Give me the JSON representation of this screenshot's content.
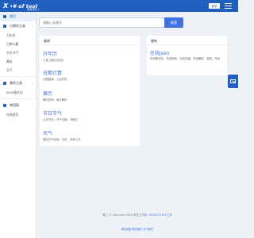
{
  "header": {
    "logo_mark": "X",
    "logo_text": "•¥ of tool",
    "link_label": "快速导航",
    "link_arrow": "▾",
    "login_label": "登录",
    "menu_icon": "hamburger-icon"
  },
  "sidebar": {
    "home": "首页",
    "groups": [
      {
        "label": "日期时工具",
        "items": [
          "万年历",
          "日期计算",
          "节日节气",
          "黄历",
          "天气"
        ]
      },
      {
        "label": "我的工具",
        "items": [
          "JSON格式化"
        ]
      },
      {
        "label": "常用网",
        "items": [
          "在线网页"
        ]
      }
    ],
    "caret": "›"
  },
  "search": {
    "placeholder": "请输入关键字",
    "button_label": "搜索"
  },
  "left_card": {
    "title": "最常",
    "tools": [
      {
        "name": "万年历",
        "desc": "工具,日期,万年历"
      },
      {
        "name": "日期计算",
        "desc": "日期相减，公历农历"
      },
      {
        "name": "黄历",
        "desc": "黄历查询，每日黄历"
      },
      {
        "name": "节日节气",
        "desc": "公众节日，节气日期，节假日"
      },
      {
        "name": "天气",
        "desc": "城区天气查询，当天，未来几天"
      }
    ]
  },
  "right_card": {
    "title": "最新",
    "tools": [
      {
        "name": "在线json",
        "desc": "在线格式化，在线校验，在线压缩，在线解析，复制，导出"
      }
    ]
  },
  "footer": {
    "line1_prefix": "微工 © cfoo.com 2024 本站工作量：",
    "line1_accent": "8420217455工具",
    "line2": "网站地图 联系我们 关于我们"
  },
  "float_button": {
    "icon": "mail-icon"
  }
}
